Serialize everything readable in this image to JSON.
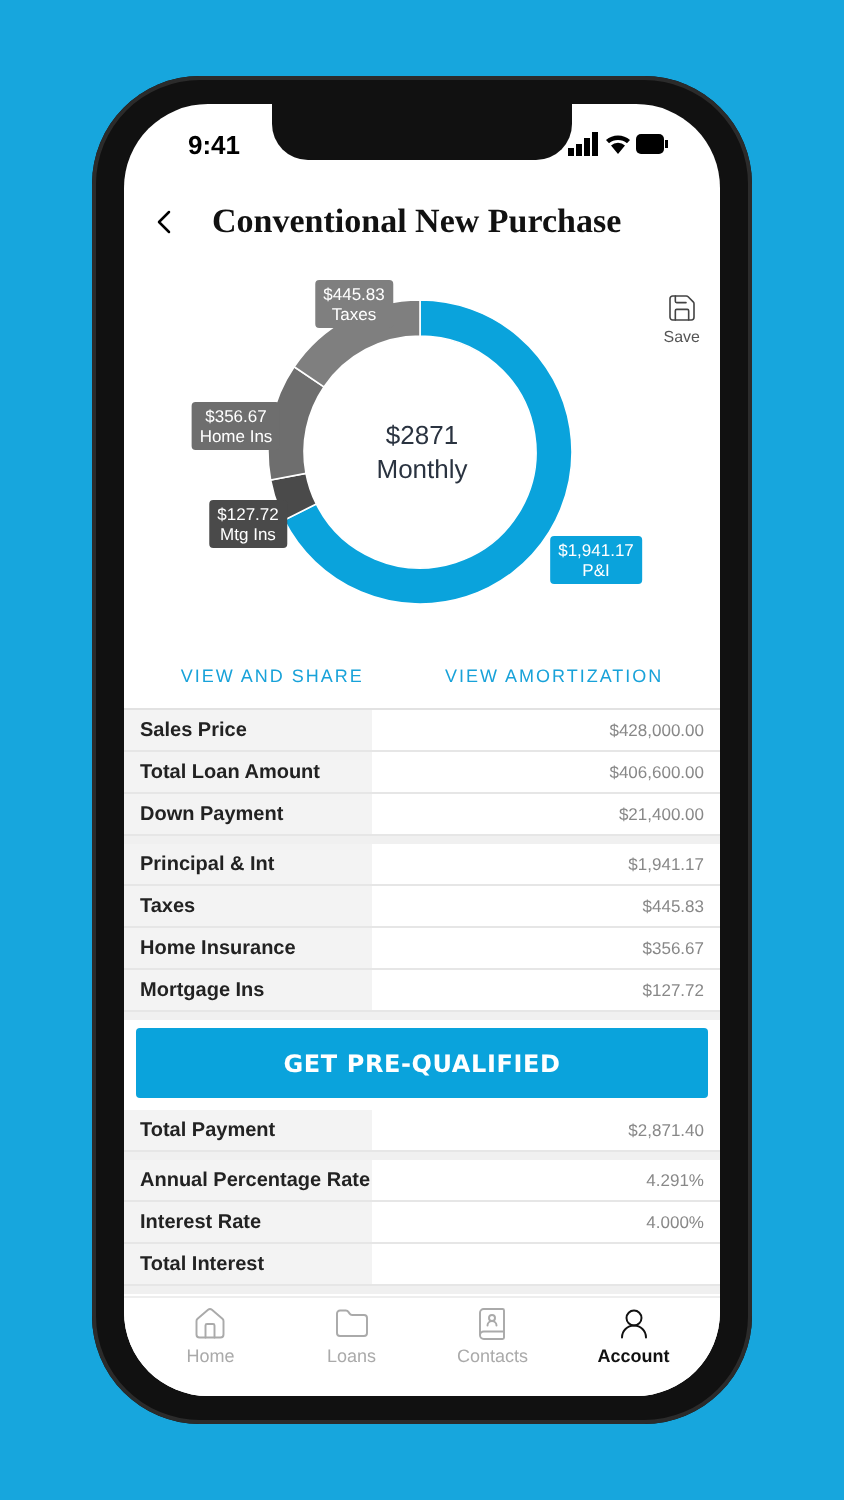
{
  "status_bar": {
    "time": "9:41"
  },
  "header": {
    "title": "Conventional New Purchase"
  },
  "save": {
    "label": "Save"
  },
  "chart": {
    "center_amount": "$2871",
    "center_caption": "Monthly",
    "chart_data": {
      "type": "donut",
      "categories": [
        "P&I",
        "Mtg Ins",
        "Home Ins",
        "Taxes"
      ],
      "values": [
        1941.17,
        127.72,
        356.67,
        445.83
      ],
      "value_labels": [
        "$1,941.17",
        "$127.72",
        "$356.67",
        "$445.83"
      ],
      "colors": [
        "#0aa3dc",
        "#4a4a4a",
        "#6e6e6e",
        "#7f7f7f"
      ]
    }
  },
  "links": [
    "VIEW AND SHARE",
    "VIEW AMORTIZATION"
  ],
  "sections": [
    {
      "rows": [
        {
          "label": "Sales Price",
          "value": "$428,000.00"
        },
        {
          "label": "Total Loan Amount",
          "value": "$406,600.00"
        },
        {
          "label": "Down Payment",
          "value": "$21,400.00"
        }
      ]
    },
    {
      "rows": [
        {
          "label": "Principal & Int",
          "value": "$1,941.17"
        },
        {
          "label": "Taxes",
          "value": "$445.83"
        },
        {
          "label": "Home Insurance",
          "value": "$356.67"
        },
        {
          "label": "Mortgage Ins",
          "value": "$127.72"
        }
      ]
    },
    {
      "button": "GET PRE-QUALIFIED",
      "rows": [
        {
          "label": "Total Payment",
          "value": "$2,871.40"
        }
      ]
    },
    {
      "rows": [
        {
          "label": "Annual Percentage Rate",
          "value": "4.291%"
        },
        {
          "label": "Interest Rate",
          "value": "4.000%"
        },
        {
          "label": "Total Interest"
        }
      ]
    }
  ],
  "tab_bar": [
    {
      "kind": "home",
      "label": "Home",
      "selected": false
    },
    {
      "kind": "loans",
      "label": "Loans",
      "selected": false
    },
    {
      "kind": "contacts",
      "label": "Contacts",
      "selected": false
    },
    {
      "kind": "account",
      "label": "Account",
      "selected": true
    }
  ]
}
